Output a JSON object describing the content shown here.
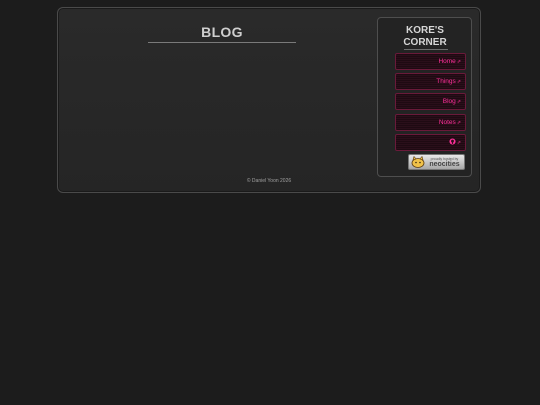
{
  "main": {
    "title": "BLOG"
  },
  "footer": {
    "text": "© Daniel Yoon 2026"
  },
  "sidebar": {
    "site_title_line1": "KORE'S",
    "site_title_line2": "CORNER",
    "nav": [
      {
        "label": "Home",
        "icon": "external-link-icon"
      },
      {
        "label": "Things",
        "icon": "external-link-icon"
      },
      {
        "label": "Blog",
        "icon": "external-link-icon"
      },
      {
        "label": "Notes",
        "icon": "external-link-icon"
      },
      {
        "label": "",
        "icon": "github-icon"
      }
    ],
    "ext_glyph": "⇗",
    "badge": {
      "small_text": "proudly hosted by",
      "big_text": "neocities"
    }
  },
  "colors": {
    "background": "#1c1c1c",
    "panel": "#262626",
    "accent_pink": "#ff2f9a",
    "text_light": "#cfcfcf"
  }
}
